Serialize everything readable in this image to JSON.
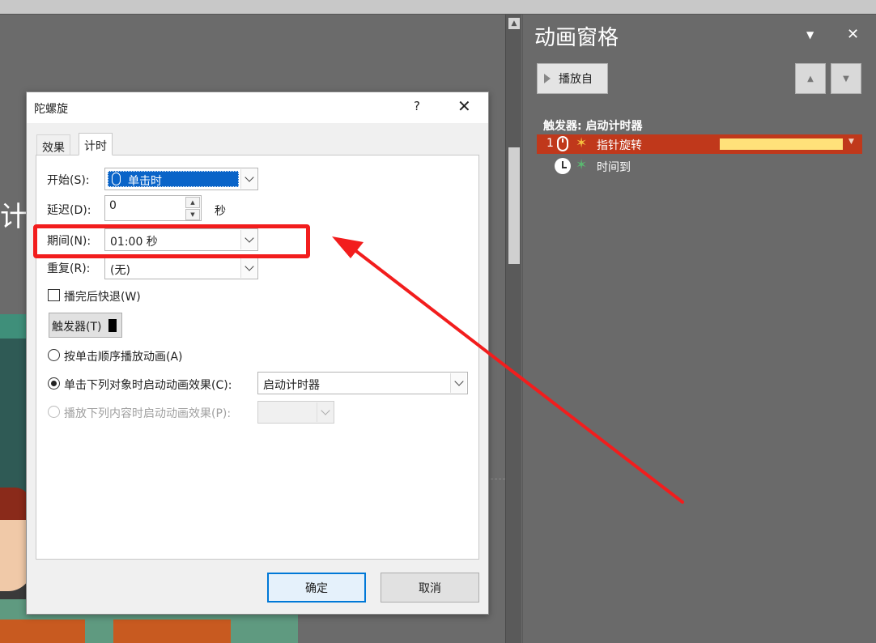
{
  "slide": {
    "partial_text": "计间"
  },
  "pane": {
    "title": "动画窗格",
    "dropdown_glyph": "▼",
    "close_glyph": "✕",
    "play_label": "播放自",
    "move_up_glyph": "▲",
    "move_down_glyph": "▼",
    "trigger_heading": "触发器: 启动计时器",
    "items": [
      {
        "number": "1",
        "label": "指针旋转",
        "selected": true
      },
      {
        "label": "时间到",
        "selected": false
      }
    ]
  },
  "dialog": {
    "title": "陀螺旋",
    "help_glyph": "?",
    "close_glyph": "✕",
    "tabs": [
      "效果",
      "计时"
    ],
    "active_tab": "计时",
    "start_label": "开始(S):",
    "start_value": "单击时",
    "delay_label": "延迟(D):",
    "delay_value": "0",
    "delay_unit": "秒",
    "duration_label": "期间(N):",
    "duration_value": "01:00 秒",
    "repeat_label": "重复(R):",
    "repeat_value": "(无)",
    "rewind_label": "播完后快退(W)",
    "rewind_checked": false,
    "trigger_button_label": "触发器(T)",
    "radio_sequence_label": "按单击顺序播放动画(A)",
    "radio_object_label": "单击下列对象时启动动画效果(C):",
    "object_value": "启动计时器",
    "radio_content_label": "播放下列内容时启动动画效果(P):",
    "content_value": "",
    "ok_label": "确定",
    "cancel_label": "取消"
  },
  "colors": {
    "selection_blue": "#0a64c8",
    "pane_selected_row": "#c0381b",
    "timeline_bar": "#ffe17a",
    "annotation_red": "#f21d1d"
  }
}
